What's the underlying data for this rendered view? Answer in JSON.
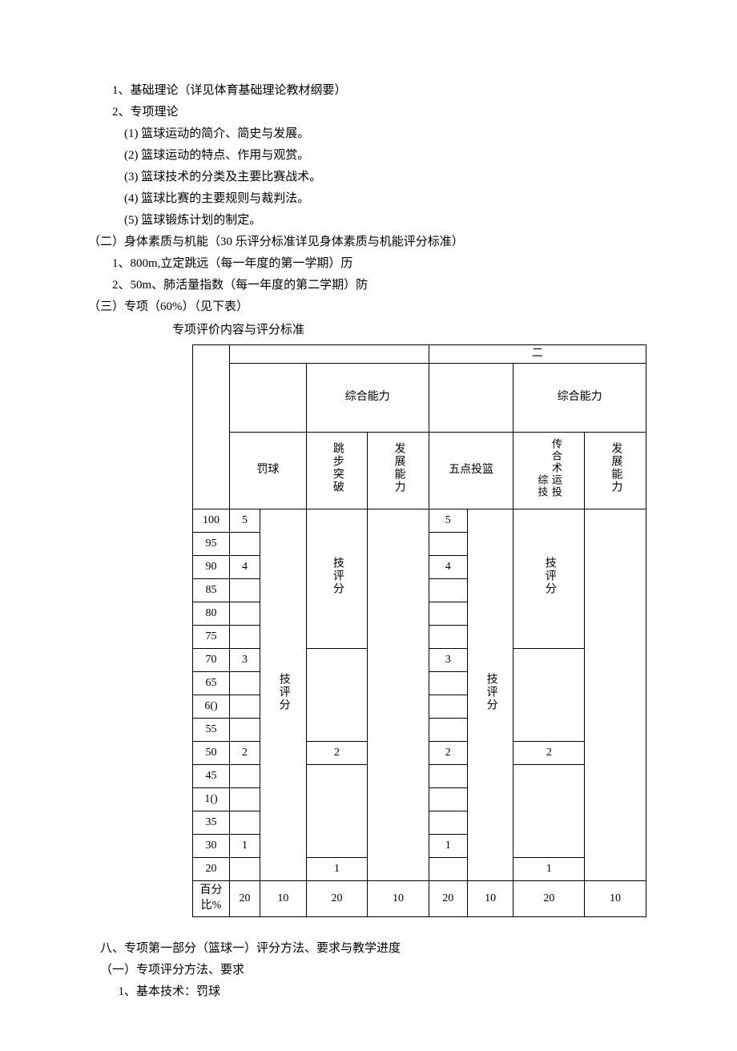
{
  "lines": {
    "l1": "1、基础理论（详见体育基础理论教材纲要）",
    "l2": "2、专项理论",
    "l3": "(1) 篮球运动的简介、简史与发展。",
    "l4": "(2) 篮球运动的特点、作用与观赏。",
    "l5": "(3) 篮球技术的分类及主要比赛战术。",
    "l6": "(4) 篮球比赛的主要规则与裁判法。",
    "l7": "(5) 篮球锻炼计划的制定。",
    "l8": "（二）身体素质与机能（30 乐评分标准详见身体素质与机能评分标准）",
    "l9": "1、800m,立定跳远（每一年度的第一学期）历",
    "l10": "2、50m、肺活量指数（每一年度的第二学期）防",
    "l11": "（三）专项（60%）（见下表）",
    "caption": "专项评价内容与评分标准",
    "s8a": "八、专项第一部分（篮球一）评分方法、要求与教学进度",
    "s8b": "（一）专项评分方法、要求",
    "s8c": "1、基本技术：罚球"
  },
  "table": {
    "top2": "二",
    "comp1": "综合能力",
    "comp2": "综合能力",
    "h_fq": "罚球",
    "h_tb": "跳步突破",
    "h_fz1": "发展能力",
    "h_wd": "五点投篮",
    "h_zj": "综技",
    "h_cs": "传合术运投",
    "h_fz2": "发展能力",
    "jpf": "技评分",
    "rows": [
      {
        "score": "100",
        "a": "5",
        "c": "",
        "e": "5",
        "g": ""
      },
      {
        "score": "95",
        "a": "",
        "c": "",
        "e": "",
        "g": ""
      },
      {
        "score": "90",
        "a": "4",
        "c": "",
        "e": "4",
        "g": ""
      },
      {
        "score": "85",
        "a": "",
        "c": "",
        "e": "",
        "g": ""
      },
      {
        "score": "80",
        "a": "",
        "c": "",
        "e": "",
        "g": ""
      },
      {
        "score": "75",
        "a": "",
        "c": "",
        "e": "",
        "g": ""
      },
      {
        "score": "70",
        "a": "3",
        "c": "",
        "e": "3",
        "g": ""
      },
      {
        "score": "65",
        "a": "",
        "c": "",
        "e": "",
        "g": ""
      },
      {
        "score": "6()",
        "a": "",
        "c": "",
        "e": "",
        "g": ""
      },
      {
        "score": "55",
        "a": "",
        "c": "",
        "e": "",
        "g": ""
      },
      {
        "score": "50",
        "a": "2",
        "c": "2",
        "e": "2",
        "g": "2"
      },
      {
        "score": "45",
        "a": "",
        "c": "",
        "e": "",
        "g": ""
      },
      {
        "score": "1()",
        "a": "",
        "c": "",
        "e": "",
        "g": ""
      },
      {
        "score": "35",
        "a": "",
        "c": "",
        "e": "",
        "g": ""
      },
      {
        "score": "30",
        "a": "1",
        "c": "",
        "e": "1",
        "g": ""
      },
      {
        "score": "20",
        "a": "",
        "c": "1",
        "e": "",
        "g": "1"
      }
    ],
    "pct_label": "百分比%",
    "pct": [
      "20",
      "10",
      "20",
      "10",
      "20",
      "10",
      "20",
      "10"
    ]
  }
}
